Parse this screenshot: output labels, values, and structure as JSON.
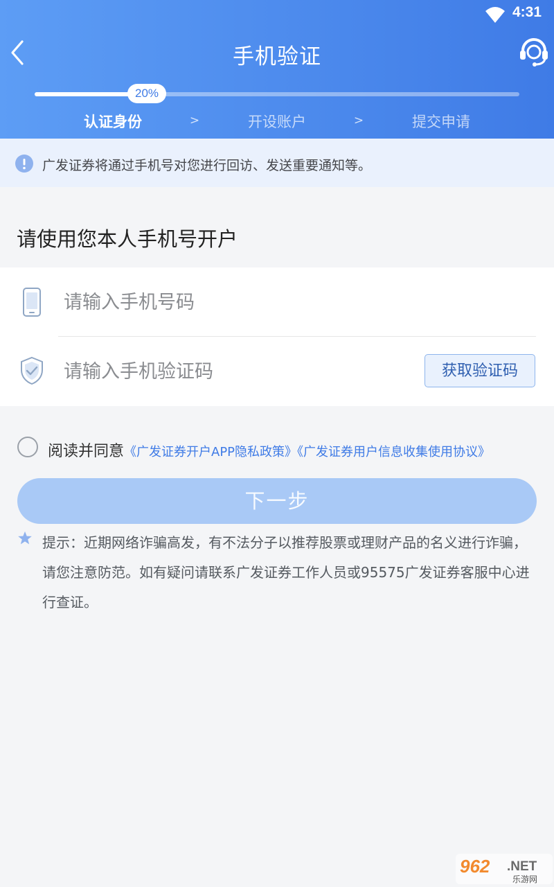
{
  "status_bar": {
    "time": "4:31"
  },
  "header": {
    "title": "手机验证",
    "progress": {
      "value": 20,
      "label": "20%"
    },
    "steps": [
      {
        "label": "认证身份",
        "active": true
      },
      {
        "label": "开设账户",
        "active": false
      },
      {
        "label": "提交申请",
        "active": false
      }
    ],
    "step_separator": ">"
  },
  "notice": {
    "text": "广发证券将通过手机号对您进行回访、发送重要通知等。"
  },
  "section": {
    "title": "请使用您本人手机号开户"
  },
  "form": {
    "phone_placeholder": "请输入手机号码",
    "phone_value": "",
    "code_placeholder": "请输入手机验证码",
    "code_value": "",
    "get_code_label": "获取验证码"
  },
  "agreement": {
    "prefix": "阅读并同意",
    "links": [
      "《广发证券开户APP隐私政策》",
      "《广发证券用户信息收集使用协议》"
    ],
    "checked": false
  },
  "next_button": {
    "label": "下一步",
    "enabled": false
  },
  "tip": {
    "text": "提示：近期网络诈骗高发，有不法分子以推荐股票或理财产品的名义进行诈骗，请您注意防范。如有疑问请联系广发证券工作人员或95575广发证券客服中心进行查证。"
  },
  "watermark": {
    "number": "962",
    "suffix": ".NET",
    "sub": "乐游网"
  },
  "colors": {
    "header_start": "#5d9df5",
    "header_end": "#3f7be6",
    "accent": "#3f7be6",
    "next_button_disabled": "#a9c9f6",
    "notice_bg": "#eaf1fd",
    "page_bg": "#f4f5f7"
  },
  "icons": {
    "back": "chevron-left-icon",
    "support": "headset-icon",
    "notice": "exclamation-icon",
    "phone": "phone-icon",
    "code": "shield-check-icon",
    "tip": "star-icon",
    "status": "wifi-icon"
  }
}
